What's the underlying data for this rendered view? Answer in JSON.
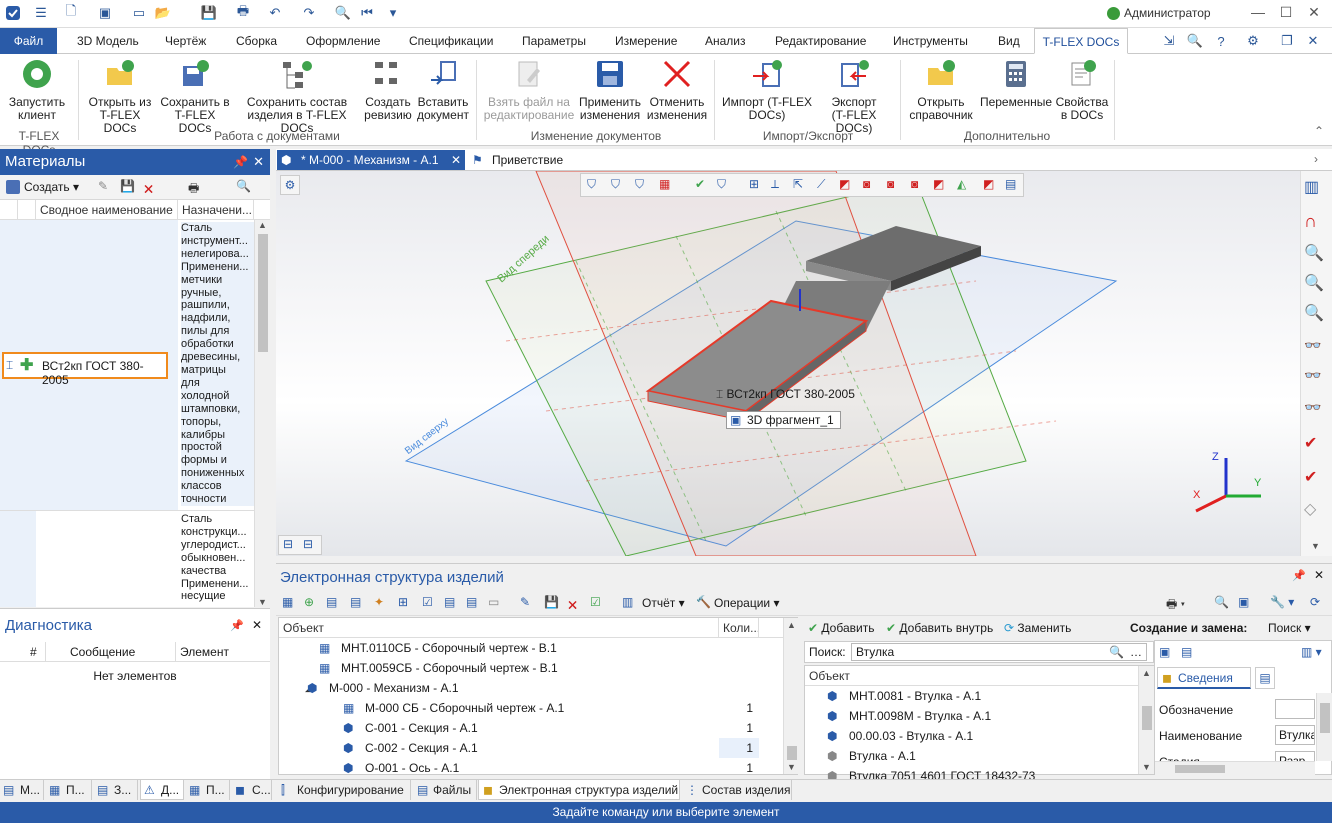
{
  "titlebar": {
    "user": "Администратор"
  },
  "menu": {
    "tabs": [
      "Файл",
      "3D Модель",
      "Чертёж",
      "Сборка",
      "Оформление",
      "Спецификации",
      "Параметры",
      "Измерение",
      "Анализ",
      "Редактирование",
      "Инструменты",
      "Вид",
      "T-FLEX DOCs"
    ]
  },
  "ribbon": {
    "buttons": [
      {
        "label1": "Запустить",
        "label2": "клиент"
      },
      {
        "label1": "Открыть из",
        "label2": "T-FLEX DOCs"
      },
      {
        "label1": "Сохранить в",
        "label2": "T-FLEX DOCs"
      },
      {
        "label1": "Сохранить состав",
        "label2": "изделия в T-FLEX DOCs"
      },
      {
        "label1": "Создать",
        "label2": "ревизию"
      },
      {
        "label1": "Вставить",
        "label2": "документ"
      },
      {
        "label1": "Взять файл на",
        "label2": "редактирование"
      },
      {
        "label1": "Применить",
        "label2": "изменения"
      },
      {
        "label1": "Отменить",
        "label2": "изменения"
      },
      {
        "label1": "Импорт (T-FLEX",
        "label2": "DOCs)"
      },
      {
        "label1": "Экспорт",
        "label2": "(T-FLEX DOCs)"
      },
      {
        "label1": "Открыть",
        "label2": "справочник"
      },
      {
        "label1": "Переменные",
        "label2": ""
      },
      {
        "label1": "Свойства",
        "label2": "в DOCs"
      }
    ],
    "groups": [
      "T-FLEX DOCs",
      "Работа с документами",
      "Изменение документов",
      "Импорт/Экспорт",
      "Дополнительно"
    ]
  },
  "materials": {
    "title": "Материалы",
    "create": "Создать",
    "columns": [
      "Сводное наименование",
      "Назначени..."
    ],
    "purpose1": [
      "Сталь",
      "инструмент...",
      "нелегирова...",
      "Применени...",
      "метчики",
      "ручные,",
      "рашпили,",
      "надфили,",
      "пилы для",
      "обработки",
      "древесины,",
      "матрицы",
      "для",
      "холодной",
      "штамповки,",
      "топоры,",
      "калибры",
      "простой",
      "формы и",
      "пониженных",
      "классов",
      "точности"
    ],
    "purpose2": [
      "Сталь",
      "конструкци...",
      "углеродист...",
      "обыкновен...",
      "качества",
      "Применени...",
      "несущие"
    ],
    "selected": "ВСт2кп ГОСТ 380-2005"
  },
  "diagnostics": {
    "title": "Диагностика",
    "columns": [
      "#",
      "Сообщение",
      "Элемент"
    ],
    "empty": "Нет элементов"
  },
  "doc_tabs": {
    "active": "* М-000 - Механизм - А.1",
    "other": "Приветствие"
  },
  "viewport": {
    "plane_front": "Вид спереди",
    "plane_top": "Вид сверху",
    "tooltip_material": "ВСт2кп ГОСТ 380-2005",
    "tooltip_fragment": "3D фрагмент_1",
    "axis_x": "X",
    "axis_y": "Y",
    "axis_z": "Z"
  },
  "structure": {
    "title": "Электронная структура изделий",
    "report": "Отчёт",
    "operations": "Операции",
    "columns": [
      "Объект",
      "Коли..."
    ],
    "rows": [
      {
        "name": "МНТ.0110СБ - Сборочный чертеж - В.1",
        "qty": ""
      },
      {
        "name": "МНТ.0059СБ - Сборочный чертеж - В.1",
        "qty": ""
      },
      {
        "name": "М-000 - Механизм - А.1",
        "qty": ""
      },
      {
        "name": "М-000 СБ - Сборочный чертеж - А.1",
        "qty": "1"
      },
      {
        "name": "С-001 - Секция - А.1",
        "qty": "1"
      },
      {
        "name": "С-002 - Секция - А.1",
        "qty": "1"
      },
      {
        "name": "О-001 - Ось - А.1",
        "qty": "1"
      }
    ]
  },
  "replace": {
    "add": "Добавить",
    "add_inside": "Добавить внутрь",
    "replace": "Заменить",
    "mode_label": "Создание и замена:",
    "mode_value": "Поиск",
    "search_label": "Поиск:",
    "search_value": "Втулка",
    "col": "Объект",
    "rows": [
      "МНТ.0081 - Втулка - А.1",
      "МНТ.0098М - Втулка - А.1",
      "00.00.03 - Втулка - А.1",
      "Втулка  - А.1",
      "Втулка 7051 4601 ГОСТ 18432-73"
    ]
  },
  "info": {
    "tab": "Сведения",
    "fields": [
      {
        "label": "Обозначение",
        "value": ""
      },
      {
        "label": "Наименование",
        "value": "Втулка"
      },
      {
        "label": "Стадия",
        "value": "Разр"
      }
    ]
  },
  "bottom_tabs_left": [
    "М...",
    "П...",
    "З...",
    "Д...",
    "П...",
    "С..."
  ],
  "bottom_tabs_right": [
    "Конфигурирование",
    "Файлы",
    "Электронная структура изделий",
    "Состав изделия"
  ],
  "status": "Задайте команду или выберите элемент"
}
